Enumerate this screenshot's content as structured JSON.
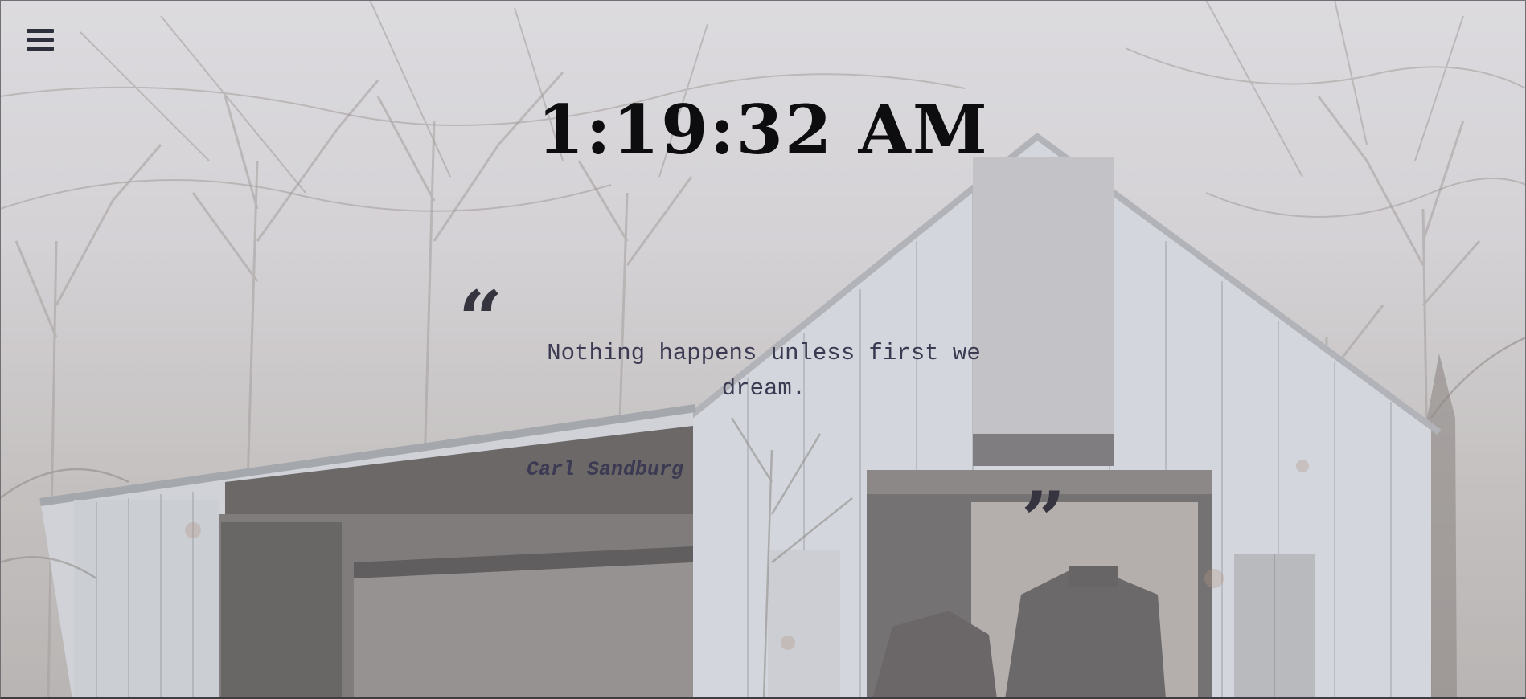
{
  "menu": {
    "icon": "hamburger-menu-icon"
  },
  "clock": {
    "time": "1:19:32 AM"
  },
  "quote": {
    "open_mark": "“",
    "close_mark": "”",
    "text": "Nothing happens unless first we dream.",
    "author": "Carl Sandburg"
  },
  "colors": {
    "clock_text": "#0d0d10",
    "quote_text": "#3b3a52",
    "quote_marks": "#35343f",
    "menu_icon": "#2e2f3d"
  }
}
